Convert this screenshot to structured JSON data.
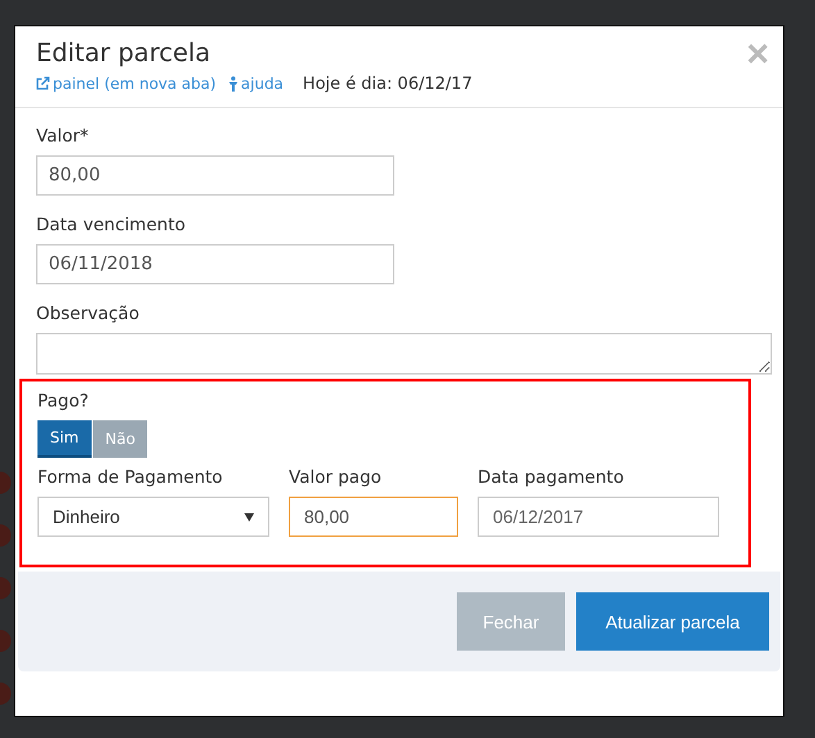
{
  "modal": {
    "title": "Editar parcela",
    "links": [
      {
        "kind": "external",
        "label": "painel (em nova aba)"
      },
      {
        "kind": "help",
        "label": "ajuda"
      }
    ],
    "today": "Hoje é dia: 06/12/17",
    "close": "×",
    "fields": [
      {
        "label": "Valor*",
        "value": "80,00"
      },
      {
        "label": "Data vencimento",
        "value": "06/11/2018"
      }
    ],
    "note": {
      "label": "Observação"
    },
    "paid": {
      "label": "Pago?",
      "options": [
        {
          "label": "Sim",
          "selected": true
        },
        {
          "label": "Não",
          "selected": false
        }
      ]
    },
    "payment": [
      {
        "kind": "select",
        "label": "Forma de Pagamento",
        "value": "Dinheiro",
        "focused": false,
        "disabled": false
      },
      {
        "kind": "input",
        "label": "Valor pago",
        "value": "80,00",
        "focused": true,
        "disabled": false
      },
      {
        "kind": "input",
        "label": "Data pagamento",
        "value": "06/12/2017",
        "focused": false,
        "disabled": true
      }
    ],
    "buttons": [
      {
        "label": "Fechar",
        "kind": "secondary"
      },
      {
        "label": "Atualizar parcela",
        "kind": "primary"
      }
    ]
  }
}
